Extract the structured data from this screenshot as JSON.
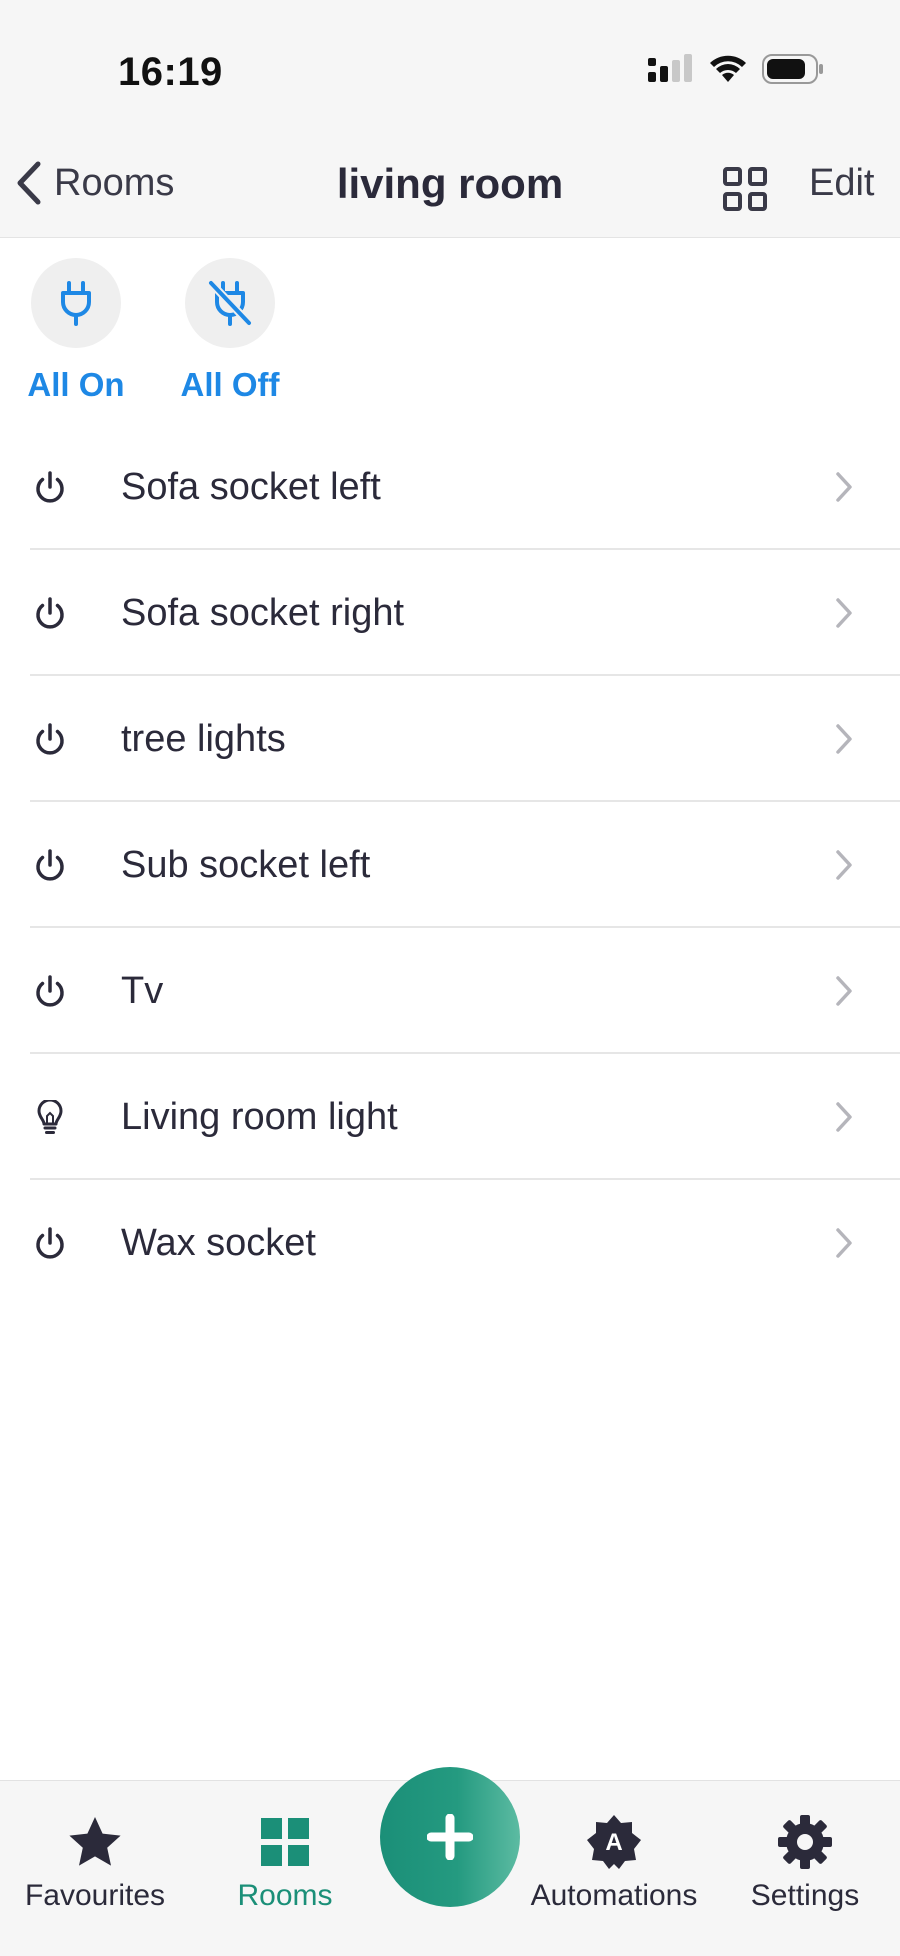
{
  "status_bar": {
    "time": "16:19"
  },
  "nav": {
    "back_label": "Rooms",
    "title": "living room",
    "edit_label": "Edit"
  },
  "quick_actions": {
    "all_on": "All On",
    "all_off": "All Off"
  },
  "devices": [
    {
      "name": "Sofa socket left",
      "icon": "power-icon"
    },
    {
      "name": "Sofa socket right",
      "icon": "power-icon"
    },
    {
      "name": "tree lights",
      "icon": "power-icon"
    },
    {
      "name": "Sub socket left",
      "icon": "power-icon"
    },
    {
      "name": "Tv",
      "icon": "power-icon"
    },
    {
      "name": "Living room light",
      "icon": "lightbulb-icon"
    },
    {
      "name": "Wax socket",
      "icon": "power-icon"
    }
  ],
  "tabs": {
    "favourites": "Favourites",
    "rooms": "Rooms",
    "automations": "Automations",
    "settings": "Settings",
    "active": "rooms"
  },
  "colors": {
    "accent_blue": "#1e88e5",
    "accent_green": "#1b8f78",
    "text": "#2b2a3a"
  }
}
